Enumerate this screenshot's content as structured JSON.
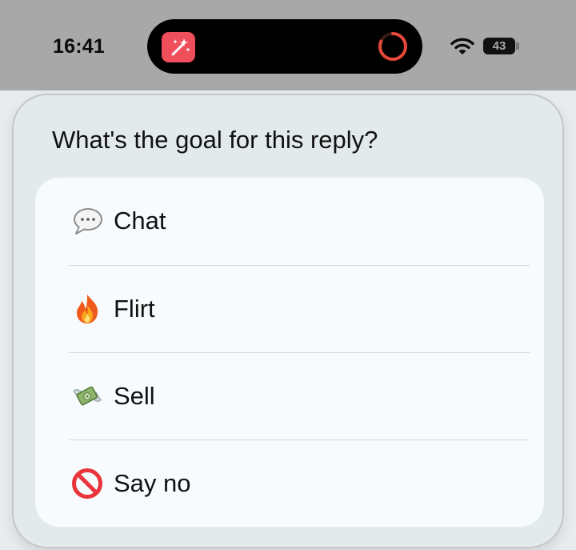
{
  "status_bar": {
    "time": "16:41",
    "battery_level": "43",
    "wifi_icon": "wifi-icon",
    "activity_app_icon": "magic-wand-icon"
  },
  "sheet": {
    "title": "What's the goal for this reply?",
    "options": [
      {
        "icon": "speech-bubble-icon",
        "label": "Chat"
      },
      {
        "icon": "fire-icon",
        "label": "Flirt"
      },
      {
        "icon": "money-with-wings-icon",
        "label": "Sell"
      },
      {
        "icon": "prohibited-icon",
        "label": "Say no"
      }
    ]
  },
  "colors": {
    "status_bar_bg": "#a8a8a8",
    "app_icon": "#ef4e5b",
    "activity_ring": "#e5483a",
    "card_bg": "#f7fbfd",
    "sheet_bg": "#e2e9ec"
  }
}
